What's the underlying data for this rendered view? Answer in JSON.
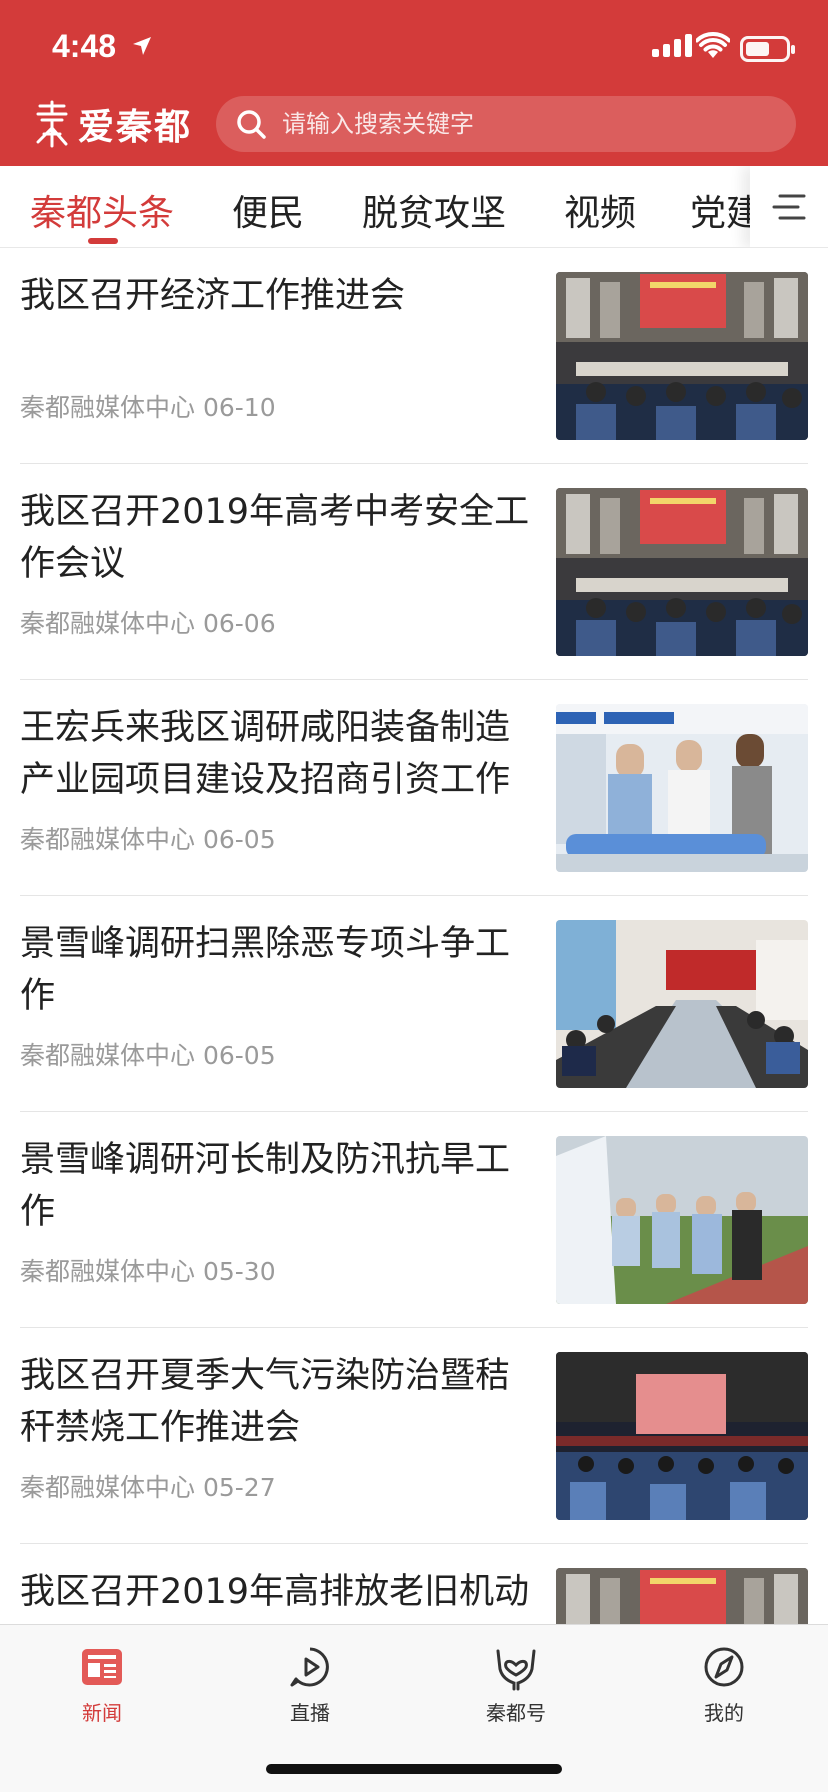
{
  "status_bar": {
    "time": "4:48",
    "battery_level": 0.6
  },
  "header": {
    "brand_name": "爱秦都",
    "search": {
      "placeholder": "请输入搜索关键字"
    },
    "background_color": "#d33b3a"
  },
  "tabs": [
    {
      "label": "秦都头条",
      "active": true
    },
    {
      "label": "便民",
      "active": false
    },
    {
      "label": "脱贫攻坚",
      "active": false
    },
    {
      "label": "视频",
      "active": false
    },
    {
      "label": "党建",
      "active": false
    }
  ],
  "news": [
    {
      "title": "我区召开经济工作推进会",
      "source": "秦都融媒体中心",
      "date": "06-10",
      "thumb": "meeting-hall"
    },
    {
      "title": "我区召开2019年高考中考安全工作会议",
      "source": "秦都融媒体中心",
      "date": "06-06",
      "thumb": "meeting-hall"
    },
    {
      "title": "王宏兵来我区调研咸阳装备制造产业园项目建设及招商引资工作",
      "source": "秦都融媒体中心",
      "date": "06-05",
      "thumb": "factory-visit"
    },
    {
      "title": "景雪峰调研扫黑除恶专项斗争工作",
      "source": "秦都融媒体中心",
      "date": "06-05",
      "thumb": "conference-table"
    },
    {
      "title": "景雪峰调研河长制及防汛抗旱工作",
      "source": "秦都融媒体中心",
      "date": "05-30",
      "thumb": "outdoor-visit"
    },
    {
      "title": "我区召开夏季大气污染防治暨秸秆禁烧工作推进会",
      "source": "秦都融媒体中心",
      "date": "05-27",
      "thumb": "auditorium"
    },
    {
      "title": "我区召开2019年高排放老旧机动",
      "source": "",
      "date": "",
      "thumb": "meeting-hall"
    }
  ],
  "bottom_nav": [
    {
      "label": "新闻",
      "icon": "news-icon",
      "active": true
    },
    {
      "label": "直播",
      "icon": "play-icon",
      "active": false
    },
    {
      "label": "秦都号",
      "icon": "heart-hands-icon",
      "active": false
    },
    {
      "label": "我的",
      "icon": "compass-icon",
      "active": false
    }
  ],
  "colors": {
    "accent": "#d33b3a",
    "meta_text": "#9a9a9a"
  }
}
